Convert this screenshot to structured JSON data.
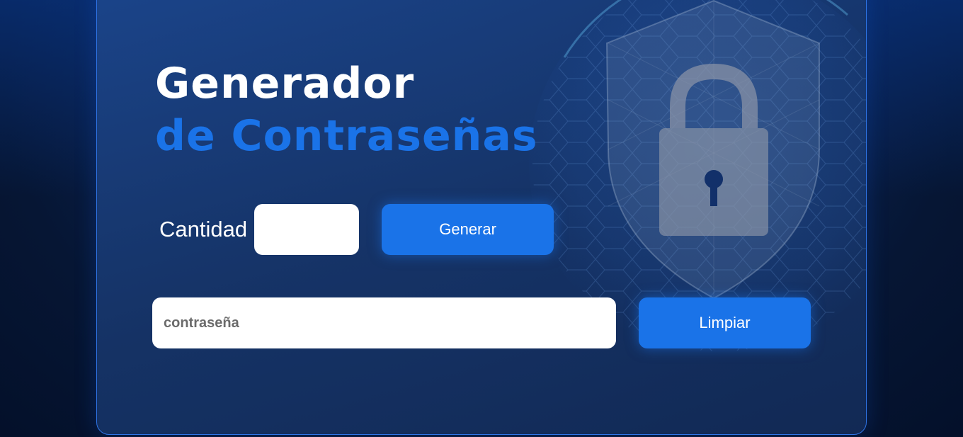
{
  "title": {
    "line1": "Generador",
    "line2": "de Contraseñas"
  },
  "generator": {
    "quantity_label": "Cantidad",
    "quantity_value": "",
    "generate_label": "Generar"
  },
  "output": {
    "placeholder": "contraseña",
    "value": "",
    "clear_label": "Limpiar"
  },
  "decor": {
    "background_icon": "shield-lock-globe-icon"
  },
  "colors": {
    "accent": "#1a73e8",
    "title_white": "#ffffff",
    "card_border": "#2f74e6"
  }
}
